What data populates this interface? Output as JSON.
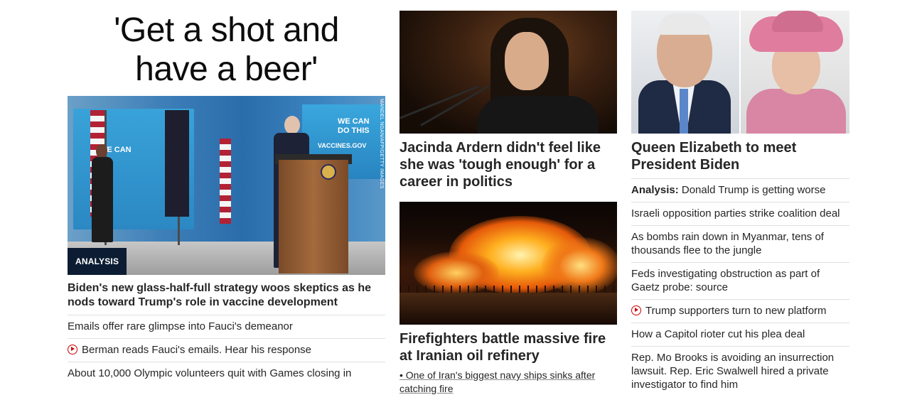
{
  "left": {
    "headline": [
      "'Get a shot and",
      "have a beer'"
    ],
    "image": {
      "badge": "ANALYSIS",
      "credit": "MANDEL NGAN/AFP/GETTY IMAGES",
      "screen_text": [
        "WE CAN",
        "DO THIS"
      ],
      "screen_url": "VACCINES.GOV",
      "screen_small": "WE CAN"
    },
    "lead": "Biden's new glass-half-full strategy woos skeptics as he nods toward Trump's role in vaccine development",
    "items": [
      {
        "text": "Emails offer rare glimpse into Fauci's demeanor",
        "video": false
      },
      {
        "text": "Berman reads Fauci's emails. Hear his response",
        "video": true
      },
      {
        "text": "About 10,000 Olympic volunteers quit with Games closing in",
        "video": false
      }
    ]
  },
  "middle": {
    "story1": {
      "headline": "Jacinda Ardern didn't feel like she was 'tough enough' for a career in politics"
    },
    "story2": {
      "headline": "Firefighters battle massive fire at Iranian oil refinery",
      "sub": "• One of Iran's biggest navy ships sinks after catching fire"
    }
  },
  "right": {
    "headline": "Queen Elizabeth to meet President Biden",
    "items": [
      {
        "label": "Analysis:",
        "text": " Donald Trump is getting worse",
        "video": false
      },
      {
        "label": "",
        "text": "Israeli opposition parties strike coalition deal",
        "video": false
      },
      {
        "label": "",
        "text": "As bombs rain down in Myanmar, tens of thousands flee to the jungle",
        "video": false
      },
      {
        "label": "",
        "text": "Feds investigating obstruction as part of Gaetz probe: source",
        "video": false
      },
      {
        "label": "",
        "text": "Trump supporters turn to new platform",
        "video": true
      },
      {
        "label": "",
        "text": "How a Capitol rioter cut his plea deal",
        "video": false
      },
      {
        "label": "",
        "text": "Rep. Mo Brooks is avoiding an insurrection lawsuit. Rep. Eric Swalwell hired a private investigator to find him",
        "video": false
      }
    ]
  },
  "colors": {
    "text": "#262626",
    "badge_bg": "#0c1d33",
    "play_red": "#cc0000",
    "divider": "#e0e0e0"
  }
}
